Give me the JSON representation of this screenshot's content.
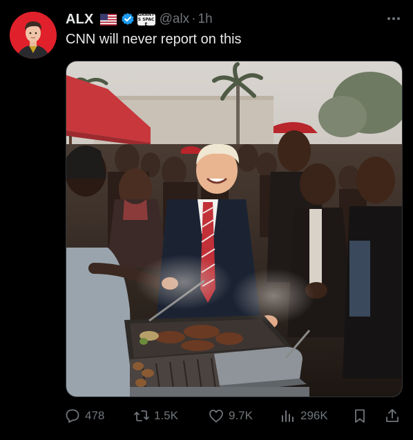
{
  "author": {
    "display_name": "ALX",
    "flag_icon": "us-flag-icon",
    "verified_color": "#1d9bf0",
    "affiliate_badge_text": "GRNNYS SPACE",
    "handle": "@alx",
    "separator": "·",
    "time": "1h"
  },
  "tweet": {
    "text": "CNN will never report on this",
    "media_alt": "photo of a smiling man in a suit and red striped tie at an outdoor grill surrounded by a crowd of people"
  },
  "actions": {
    "replies": "478",
    "retweets": "1.5K",
    "likes": "9.7K",
    "views": "296K"
  },
  "colors": {
    "background": "#000000",
    "text": "#e7e9ea",
    "secondary": "#71767b",
    "avatar_bg": "#e0212b"
  }
}
